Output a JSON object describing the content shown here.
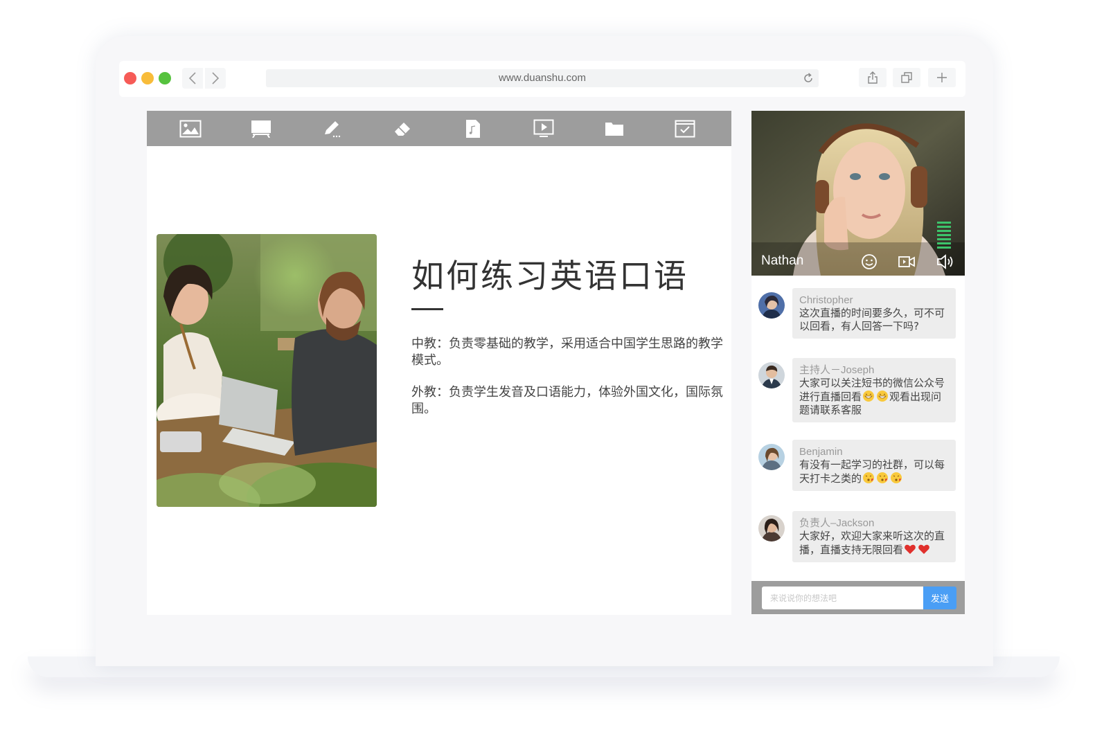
{
  "browser": {
    "url": "www.duanshu.com"
  },
  "board": {
    "toolbar": [
      {
        "name": "image-icon"
      },
      {
        "name": "projector-screen-icon"
      },
      {
        "name": "pencil-icon"
      },
      {
        "name": "eraser-icon"
      },
      {
        "name": "music-file-icon"
      },
      {
        "name": "video-play-icon"
      },
      {
        "name": "folder-icon"
      },
      {
        "name": "checklist-icon"
      }
    ],
    "slide": {
      "title": "如何练习英语口语",
      "para1": "中教：负责零基础的教学，采用适合中国学生思路的教学模式。",
      "para2": "外教：负责学生发音及口语能力，体验外国文化，国际氛围。"
    }
  },
  "video": {
    "name": "Nathan"
  },
  "chat": {
    "messages": [
      {
        "sender": "Christopher",
        "text": "这次直播的时间要多久，可不可以回看，有人回答一下吗?"
      },
      {
        "sender": "主持人－Joseph",
        "text_a": "大家可以关注短书的微信公众号进行直播回看",
        "text_b": "观看出现问题请联系客服",
        "emoji": "grin-emoji"
      },
      {
        "sender": "Benjamin",
        "text": "有没有一起学习的社群，可以每天打卡之类的",
        "emoji": "kiss-emoji"
      },
      {
        "sender": "负责人–Jackson",
        "text": "大家好，欢迎大家来听这次的直播，直播支持无限回看",
        "emoji": "heart-emoji"
      }
    ],
    "input_placeholder": "来说说你的想法吧",
    "send_label": "发送"
  },
  "colors": {
    "toolbar_gray": "#9d9d9d",
    "send_blue": "#4a9ef5",
    "meter_green": "#3cc46b"
  }
}
